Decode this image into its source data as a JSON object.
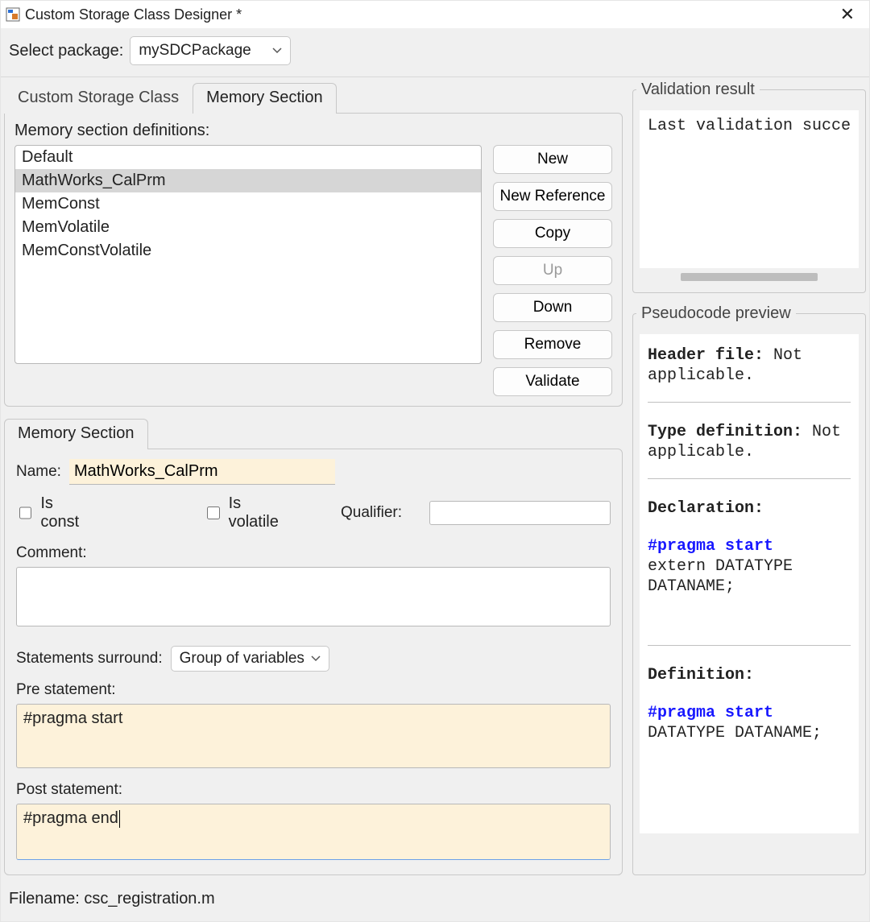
{
  "window": {
    "title": "Custom Storage Class Designer *"
  },
  "toolbar": {
    "select_package_label": "Select package:",
    "package_value": "mySDCPackage"
  },
  "tabs": {
    "csc": "Custom Storage Class",
    "mem": "Memory Section"
  },
  "definitions": {
    "label": "Memory section definitions:",
    "items": [
      "Default",
      "MathWorks_CalPrm",
      "MemConst",
      "MemVolatile",
      "MemConstVolatile"
    ],
    "selected_index": 1
  },
  "buttons": {
    "new": "New",
    "new_ref": "New Reference",
    "copy": "Copy",
    "up": "Up",
    "down": "Down",
    "remove": "Remove",
    "validate": "Validate"
  },
  "detail_tab": {
    "label": "Memory Section"
  },
  "form": {
    "name_label": "Name:",
    "name_value": "MathWorks_CalPrm",
    "is_const_label": "Is const",
    "is_volatile_label": "Is volatile",
    "is_const": false,
    "is_volatile": false,
    "qualifier_label": "Qualifier:",
    "qualifier_value": "",
    "comment_label": "Comment:",
    "comment_value": "",
    "surround_label": "Statements surround:",
    "surround_value": "Group of variables",
    "pre_label": "Pre statement:",
    "pre_value": "#pragma start",
    "post_label": "Post statement:",
    "post_value": "#pragma end"
  },
  "footer": {
    "filename_label": "Filename:",
    "filename_value": "csc_registration.m"
  },
  "validation": {
    "title": "Validation result",
    "text": "Last validation succe"
  },
  "pseudo": {
    "title": "Pseudocode preview",
    "header_label": "Header file:",
    "header_value": "Not applicable.",
    "typedef_label": "Type definition:",
    "typedef_value": "Not applicable.",
    "decl_label": "Declaration:",
    "pragma": "#pragma start",
    "decl_line": "extern DATATYPE DATANAME;",
    "def_label": "Definition:",
    "def_line": "DATATYPE DATANAME;"
  }
}
